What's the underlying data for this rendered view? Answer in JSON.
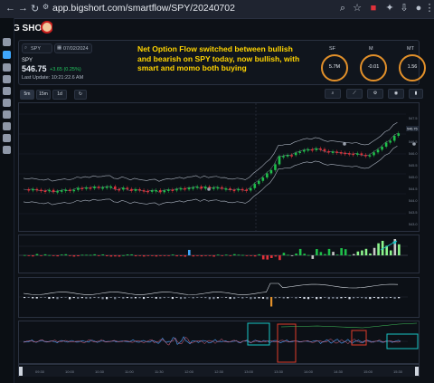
{
  "browser": {
    "url": "app.bigshort.com/smartflow/SPY/20240702"
  },
  "app": {
    "logo_text": "BIG SHORT"
  },
  "header": {
    "symbol_input": "SPY",
    "date_input": "07/02/2024",
    "symbol": "SPY",
    "price": "546.75",
    "change": "+3.65 (0.25%)",
    "last_update": "Last Update: 10:21:22.6 AM"
  },
  "annotation": "Net Option Flow switched between bullish and bearish on SPY today, now bullish, with smart and momo both buying",
  "gauges": [
    {
      "label": "SF",
      "value": "5.7M"
    },
    {
      "label": "M",
      "value": "-0.01"
    },
    {
      "label": "MT",
      "value": "1.56"
    }
  ],
  "timeframes": [
    "5m",
    "15m",
    "1d"
  ],
  "price_panel": {
    "last_label": "546.75",
    "y_ticks": [
      "547.5",
      "547.0",
      "546.5",
      "546.0",
      "545.5",
      "545.0",
      "544.5",
      "544.0",
      "543.5",
      "543.0"
    ]
  },
  "time_axis": [
    "09:30",
    "10:00",
    "10:30",
    "11:00",
    "11:30",
    "12:00",
    "12:30",
    "13:00",
    "13:30",
    "14:00",
    "14:30",
    "15:00",
    "15:30"
  ],
  "colors": {
    "up": "#1fbf4a",
    "down": "#e0323a",
    "annotation": "#ffd400",
    "highlight_teal": "#19c6c6",
    "highlight_red": "#e03b2b",
    "gauge_ring": "#e2902a"
  }
}
